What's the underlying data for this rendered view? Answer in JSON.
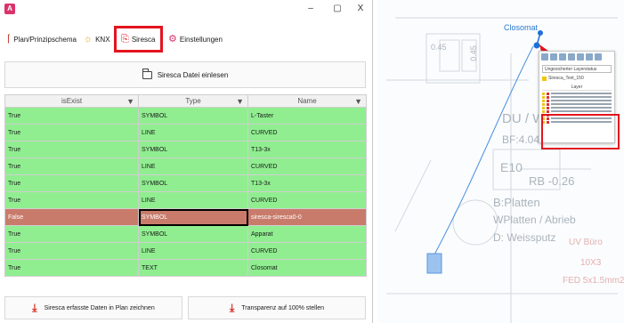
{
  "window": {
    "app_icon": "A",
    "controls": {
      "minimize": "–",
      "maximize": "▢",
      "close": "X"
    }
  },
  "tabs": [
    {
      "label": "Plan/Prinzipschema",
      "icon": "plan-icon"
    },
    {
      "label": "KNX",
      "icon": "knx-icon"
    },
    {
      "label": "Siresca",
      "icon": "pdf-icon",
      "active": true
    },
    {
      "label": "Einstellungen",
      "icon": "settings-icon"
    }
  ],
  "read_button": {
    "label": "Siresca Datei einlesen",
    "icon": "folder-icon"
  },
  "table": {
    "columns": [
      "isExist",
      "Type",
      "Name"
    ],
    "rows": [
      {
        "isExist": "True",
        "type": "SYMBOL",
        "name": "L-Taster"
      },
      {
        "isExist": "True",
        "type": "LINE",
        "name": "CURVED"
      },
      {
        "isExist": "True",
        "type": "SYMBOL",
        "name": "T13-3x"
      },
      {
        "isExist": "True",
        "type": "LINE",
        "name": "CURVED"
      },
      {
        "isExist": "True",
        "type": "SYMBOL",
        "name": "T13-3x"
      },
      {
        "isExist": "True",
        "type": "LINE",
        "name": "CURVED"
      },
      {
        "isExist": "False",
        "type": "SYMBOL",
        "name": "siresca-siresca0-0"
      },
      {
        "isExist": "True",
        "type": "SYMBOL",
        "name": "Apparat"
      },
      {
        "isExist": "True",
        "type": "LINE",
        "name": "CURVED"
      },
      {
        "isExist": "True",
        "type": "TEXT",
        "name": "Closomat"
      }
    ]
  },
  "bottom_buttons": {
    "draw": "Siresca erfasste Daten in Plan zeichnen",
    "transparency": "Transparenz auf 100% stellen"
  },
  "drawing": {
    "closomat_label": "Closomat",
    "room_labels": [
      "DU / W",
      "BF:4.04",
      "E10",
      "RB -0.26",
      "B:Platten",
      "WPlatten / Abrieb",
      "D: Weissputz",
      "UV Büro",
      "10X3",
      "FED 5x1.5mm2"
    ],
    "dim_labels": [
      "0.45",
      "0.45"
    ],
    "panel": {
      "status": "Ungesicherter Layerstatus",
      "layer_name": "Siresca_Text_150",
      "header": "Layer"
    }
  }
}
